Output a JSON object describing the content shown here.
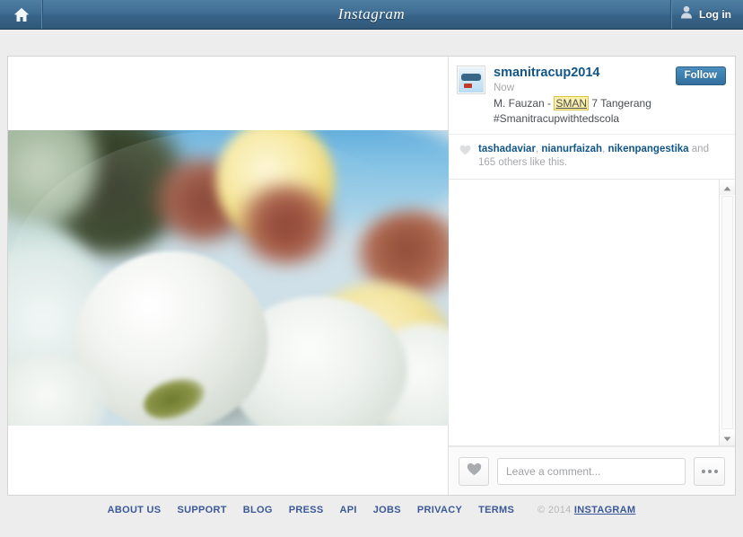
{
  "topbar": {
    "title": "Instagram",
    "home_icon": "home-icon",
    "login_label": "Log in",
    "login_icon": "user-icon"
  },
  "post": {
    "username": "smanitracup2014",
    "timestamp": "Now",
    "avatar_alt": "smanitracup2014 profile picture",
    "follow_label": "Follow",
    "caption_before": "M. Fauzan - ",
    "caption_highlight": "SMAN",
    "caption_after": " 7 Tangerang",
    "hashtag": "#Smanitracupwithtedscola"
  },
  "likes": {
    "heart_icon": "heart-icon",
    "users": [
      "tashadaviar",
      "nianurfaizah",
      "nikenpangestika"
    ],
    "separator": ", ",
    "suffix_before_count": " and ",
    "count": "165",
    "suffix_after_count": " others like this."
  },
  "comment_bar": {
    "like_icon": "heart-icon",
    "placeholder": "Leave a comment...",
    "value": "",
    "more_icon": "ellipsis-icon"
  },
  "scrollbar": {
    "up_icon": "arrow-up-icon",
    "down_icon": "arrow-down-icon"
  },
  "footer": {
    "links": [
      "ABOUT US",
      "SUPPORT",
      "BLOG",
      "PRESS",
      "API",
      "JOBS",
      "PRIVACY",
      "TERMS"
    ],
    "copyright": "© 2014",
    "brand": "INSTAGRAM"
  },
  "colors": {
    "topbar": "#3f6d93",
    "link_blue": "#125688",
    "follow_blue": "#3d7faf",
    "footer_link": "#3b5998",
    "muted": "#a5a7aa",
    "highlight_yellow": "#fdf0a8"
  }
}
